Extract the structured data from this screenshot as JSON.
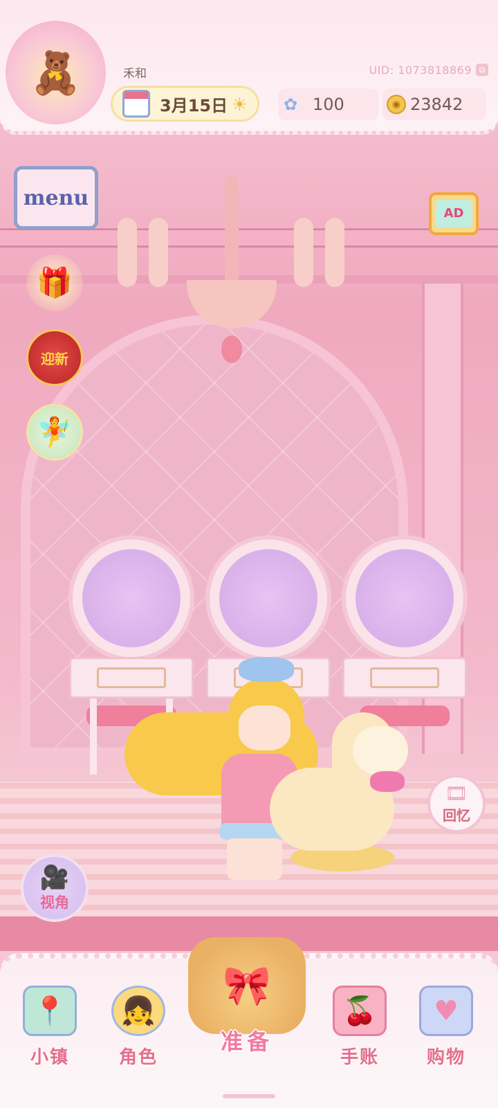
{
  "player": {
    "name": "禾和",
    "uid": "UID: 1073818869"
  },
  "date": {
    "label": "3月15日"
  },
  "resources": {
    "gems": "100",
    "coins": "23842"
  },
  "side_buttons": {
    "menu_label": "menu",
    "newyear_label": "迎新",
    "ad_label": "AD",
    "memory_label": "回忆",
    "view_label": "视角"
  },
  "bottom_nav": {
    "items": [
      {
        "label": "小镇"
      },
      {
        "label": "角色"
      },
      {
        "label": "准备"
      },
      {
        "label": "手账"
      },
      {
        "label": "购物"
      }
    ]
  },
  "icons": {
    "calendar": "calendar-icon",
    "sun": "sun-icon",
    "gem": "gem-icon",
    "coin": "coin-icon",
    "gift": "gift-icon",
    "film": "film-icon",
    "camera": "camera-icon"
  },
  "colors": {
    "accent_pink": "#e36f8d",
    "hud_bg": "#fde7ee",
    "coin_gold": "#f3c64f"
  }
}
